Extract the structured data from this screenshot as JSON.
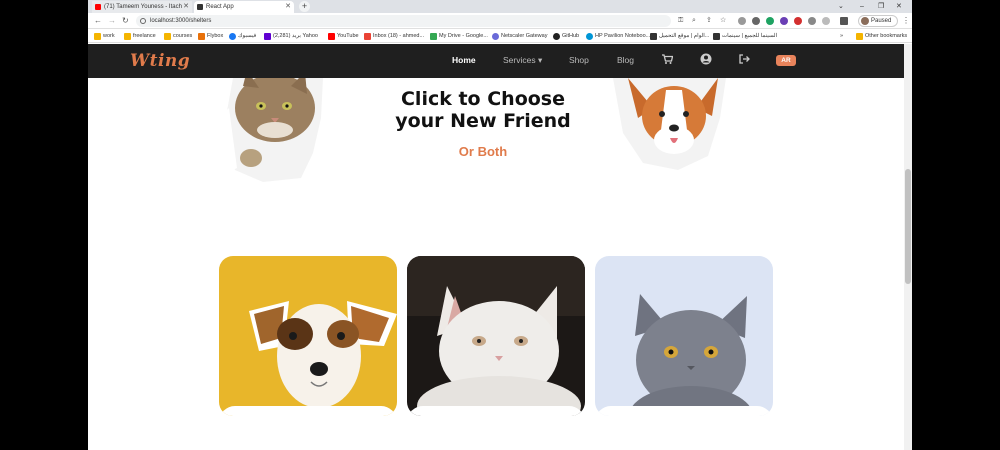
{
  "browser": {
    "tabs": [
      {
        "title": "(71) Tameem Youness - Itach",
        "favicon_color": "#ff0000"
      },
      {
        "title": "React App",
        "favicon_color": "#333333"
      }
    ],
    "new_tab": "+",
    "url": "localhost:3000/shelters",
    "profile_label": "Paused",
    "bookmarks": [
      {
        "label": "work",
        "color": "#f4b400"
      },
      {
        "label": "freelance",
        "color": "#f4b400"
      },
      {
        "label": "courses",
        "color": "#f4b400"
      },
      {
        "label": "Flybox",
        "color": "#e8710a"
      },
      {
        "label": "فيسبوك",
        "color": "#1877f2"
      },
      {
        "label": "(2,281) بريد Yahoo",
        "color": "#6001d2"
      },
      {
        "label": "YouTube",
        "color": "#ff0000"
      },
      {
        "label": "Inbox (18) - ahmed...",
        "color": "#ea4335"
      },
      {
        "label": "My Drive - Google...",
        "color": "#34a853"
      },
      {
        "label": "Netscaler Gateway",
        "color": "#6a6ad8"
      },
      {
        "label": "GitHub",
        "color": "#222222"
      },
      {
        "label": "HP Pavilion Noteboo...",
        "color": "#0096d6"
      },
      {
        "label": "الوام | موقع التحميل...",
        "color": "#333333"
      },
      {
        "label": "السينما للجميع | سينمات",
        "color": "#333333"
      }
    ],
    "other_bookmarks": "Other bookmarks"
  },
  "site": {
    "logo": "Wting",
    "nav": {
      "home": "Home",
      "services": "Services ▾",
      "shop": "Shop",
      "blog": "Blog",
      "lang": "AR"
    }
  },
  "hero": {
    "title_line1": "Click to Choose",
    "title_line2": "your New Friend",
    "subtitle": "Or Both"
  },
  "colors": {
    "accent": "#e07b4b",
    "nav_bg": "#1f1f1f"
  }
}
